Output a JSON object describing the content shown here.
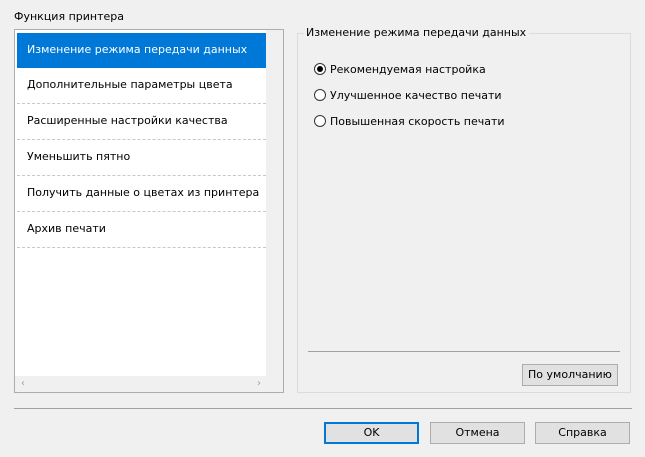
{
  "title": "Функция принтера",
  "list": {
    "items": [
      {
        "label": "Изменение режима передачи данных",
        "selected": true
      },
      {
        "label": "Дополнительные параметры цвета",
        "selected": false
      },
      {
        "label": "Расширенные настройки качества",
        "selected": false
      },
      {
        "label": "Уменьшить пятно",
        "selected": false
      },
      {
        "label": "Получить данные о цветах из принтера",
        "selected": false
      },
      {
        "label": "Архив печати",
        "selected": false
      }
    ],
    "scroll_left_glyph": "‹",
    "scroll_right_glyph": "›"
  },
  "group": {
    "legend": "Изменение режима передачи данных",
    "options": [
      {
        "label": "Рекомендуемая настройка",
        "checked": true
      },
      {
        "label": "Улучшенное качество печати",
        "checked": false
      },
      {
        "label": "Повышенная скорость печати",
        "checked": false
      }
    ],
    "default_button": "По умолчанию"
  },
  "buttons": {
    "ok": "OK",
    "cancel": "Отмена",
    "help": "Справка"
  },
  "colors": {
    "selection": "#0078d7",
    "background": "#f0f0f0"
  }
}
